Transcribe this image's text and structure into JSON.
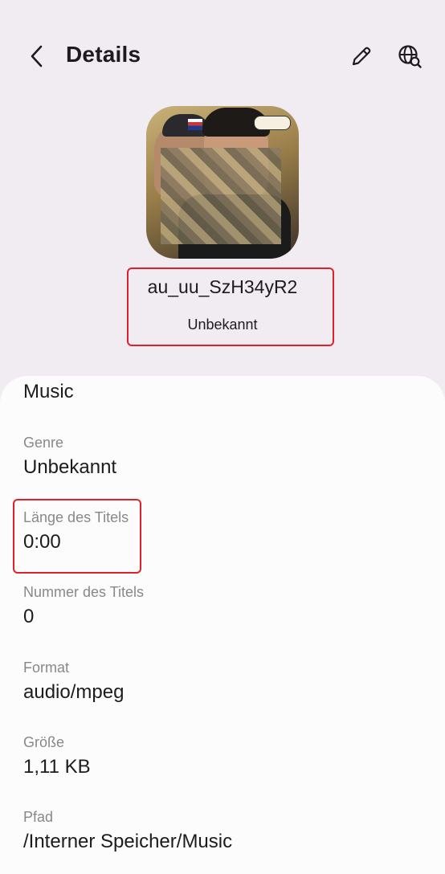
{
  "header": {
    "title": "Details",
    "back_icon": "chevron-left-icon",
    "edit_icon": "pencil-icon",
    "web_search_icon": "globe-search-icon"
  },
  "track": {
    "name": "au_uu_SzH34yR2",
    "artist": "Unbekannt"
  },
  "details": {
    "album": "Music",
    "genre_label": "Genre",
    "genre_value": "Unbekannt",
    "length_label": "Länge des Titels",
    "length_value": "0:00",
    "number_label": "Nummer des Titels",
    "number_value": "0",
    "format_label": "Format",
    "format_value": "audio/mpeg",
    "size_label": "Größe",
    "size_value": "1,11 KB",
    "path_label": "Pfad",
    "path_value": "/Interner Speicher/Music"
  },
  "colors": {
    "background": "#f1ebf2",
    "card": "#fcfcfc",
    "highlight": "#e0212b",
    "label": "#8a878b"
  }
}
